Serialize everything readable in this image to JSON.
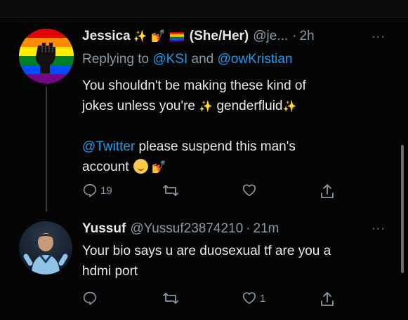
{
  "tweets": [
    {
      "name": "Jessica",
      "name_emoji": "✨",
      "hands_emoji": "💅",
      "pronouns": "(She/Her)",
      "handle": "@je...",
      "separator": "·",
      "time": "2h",
      "more": "···",
      "replying_prefix": "Replying to ",
      "replying_mentions": [
        "@KSI",
        "@owKristian"
      ],
      "replying_and": " and ",
      "lines": [
        "You shouldn't be making these kind of",
        "jokes unless you're ",
        "genderfluid"
      ],
      "sparkle": "✨",
      "mention": "@Twitter",
      "line4_rest": " please suspend this man's",
      "line5": "account",
      "reply_count": "19",
      "retweet_count": "",
      "like_count": ""
    },
    {
      "name": "Yussuf",
      "handle": "@Yussuf23874210",
      "separator": "·",
      "time": "21m",
      "more": "···",
      "lines": [
        "Your bio says u are duosexual tf are you a",
        "hdmi port"
      ],
      "reply_count": "",
      "retweet_count": "",
      "like_count": "1"
    }
  ],
  "icons": {
    "reply": "reply-icon",
    "retweet": "retweet-icon",
    "like": "heart-icon",
    "share": "share-icon",
    "more": "more-icon"
  },
  "colors": {
    "background": "#050505",
    "text": "#e7e9ea",
    "muted": "#8b98a5",
    "link": "#1d9bf0"
  }
}
